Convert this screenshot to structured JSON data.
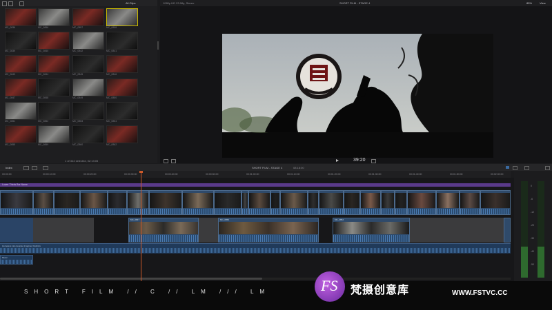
{
  "browser": {
    "header": "All Clips",
    "status": "1 of 344 selected, 02:13:05",
    "clips": [
      "MC_0836",
      "MC_0856",
      "MC_0857",
      "MC_0858",
      "MC_0839",
      "MC_0840",
      "MC_0842",
      "MC_0841",
      "MC_0843",
      "MC_0844",
      "MC_0845",
      "MC_0846",
      "MC_0847",
      "MC_0848",
      "MC_0849",
      "MC_0850",
      "MC_0851",
      "MC_0852",
      "MC_0853",
      "MC_0854",
      "MC_0855",
      "MC_0859",
      "MC_0860",
      "MC_0862"
    ]
  },
  "viewer": {
    "format": "1080p HD 23.98p, Stereo",
    "title": "SHORT FILM - STAGE 4",
    "zoom": "85%",
    "view": "View",
    "timecode": "39:20"
  },
  "timeline": {
    "index_label": "Index",
    "project": "SHORT FILM - STAGE 4",
    "duration": "08:18:00",
    "ruler": [
      "00:00:00",
      "00:00:10:00",
      "00:00:20:00",
      "00:00:30:00",
      "00:00:40:00",
      "00:00:50:00",
      "00:01:00:00",
      "00:01:10:00",
      "00:01:20:00",
      "00:01:30:00",
      "00:01:40:00",
      "00:01:50:00",
      "00:02:00:00"
    ],
    "clip_labels": [
      "MC_0847",
      "MC_0850",
      "MC_0852"
    ],
    "title_clip": "Lower Thirds Bar Name",
    "audio_clip": "Homeless nice despise Imagined Instincts",
    "music_clip": "Music",
    "meter_scale": [
      "0",
      "-6",
      "-12",
      "-20",
      "-30",
      "-40",
      "-50"
    ]
  },
  "overlay": {
    "caption": "SHORT FILM // C // LM /// LM",
    "logo_letters": "FS",
    "site_name": "梵摄创意库",
    "site_url": "WWW.FSTVC.CC"
  }
}
